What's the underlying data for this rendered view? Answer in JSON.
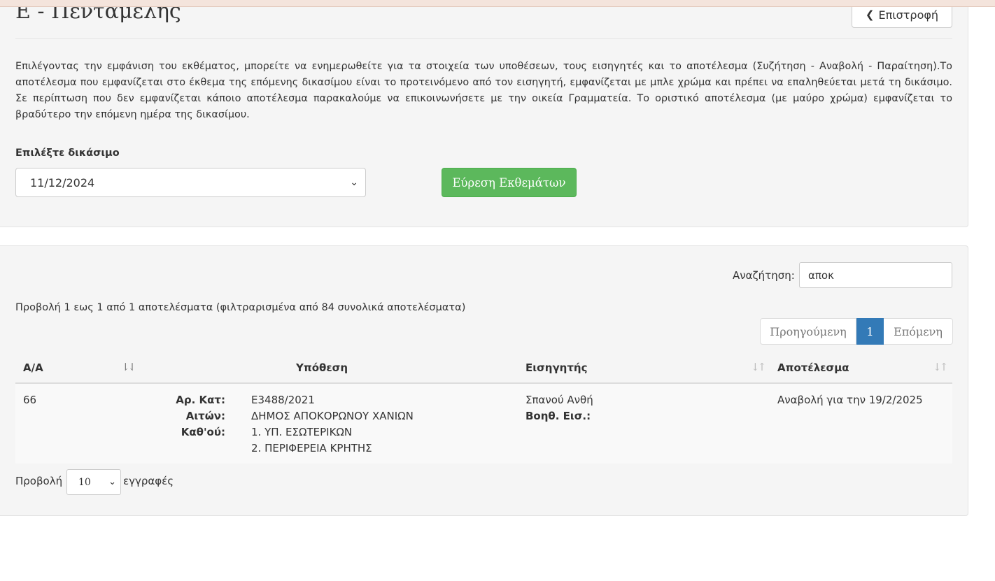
{
  "header": {
    "title": "Ε - Πενταμελής",
    "back_label": "Επιστροφή"
  },
  "intro": "Επιλέγοντας την εμφάνιση του εκθέματος, μπορείτε να ενημερωθείτε για τα στοιχεία των υποθέσεων, τους εισηγητές και το αποτέλεσμα (Συζήτηση - Αναβολή - Παραίτηση).Το αποτέλεσμα που εμφανίζεται στο έκθεμα της επόμενης δικασίμου είναι το προτεινόμενο από τον εισηγητή, εμφανίζεται με μπλε χρώμα και πρέπει να επαληθεύεται μετά τη δικάσιμο. Σε περίπτωση που δεν εμφανίζεται κάποιο αποτέλεσμα παρακαλούμε να επικοινωνήσετε με την οικεία Γραμματεία. Το οριστικό αποτέλεσμα (με μαύρο χρώμα) εμφανίζεται το βραδύτερο την επόμενη ημέρα της δικασίμου.",
  "form": {
    "date_label": "Επιλέξτε δικάσιμο",
    "date_value": "11/12/2024",
    "find_label": "Εύρεση Εκθεμάτων"
  },
  "search": {
    "label": "Αναζήτηση:",
    "value": "αποκ"
  },
  "info": "Προβολή 1 εως 1 από 1 αποτελέσματα (φιλτραρισμένα από 84 συνολικά αποτελέσματα)",
  "pagination": {
    "prev": "Προηγούμενη",
    "current": "1",
    "next": "Επόμενη"
  },
  "table": {
    "headers": [
      "Α/Α",
      "Υπόθεση",
      "Εισηγητής",
      "Αποτέλεσμα"
    ],
    "rows": [
      {
        "aa": "66",
        "labels": [
          "Αρ. Κατ:",
          "Αιτών:",
          "Καθ'ού:"
        ],
        "ar_kat": "Ε3488/2021",
        "aiton": "ΔΗΜΟΣ ΑΠΟΚΟΡΩΝΟΥ ΧΑΝΙΩΝ",
        "kathou": [
          "1. ΥΠ. ΕΣΩΤΕΡΙΚΩΝ",
          "2. ΠΕΡΙΦΕΡΕΙΑ ΚΡΗΤΗΣ"
        ],
        "eisigitis": "Σπανού Ανθή",
        "voith_label": "Βοηθ. Εισ.:",
        "apotelesma": "Αναβολή για την 19/2/2025"
      }
    ]
  },
  "length": {
    "prefix": "Προβολή",
    "value": "10",
    "suffix": "εγγραφές"
  },
  "colors": {
    "success": "#5cb85c",
    "primary": "#337ab7",
    "panel": "#f5f5f5"
  }
}
